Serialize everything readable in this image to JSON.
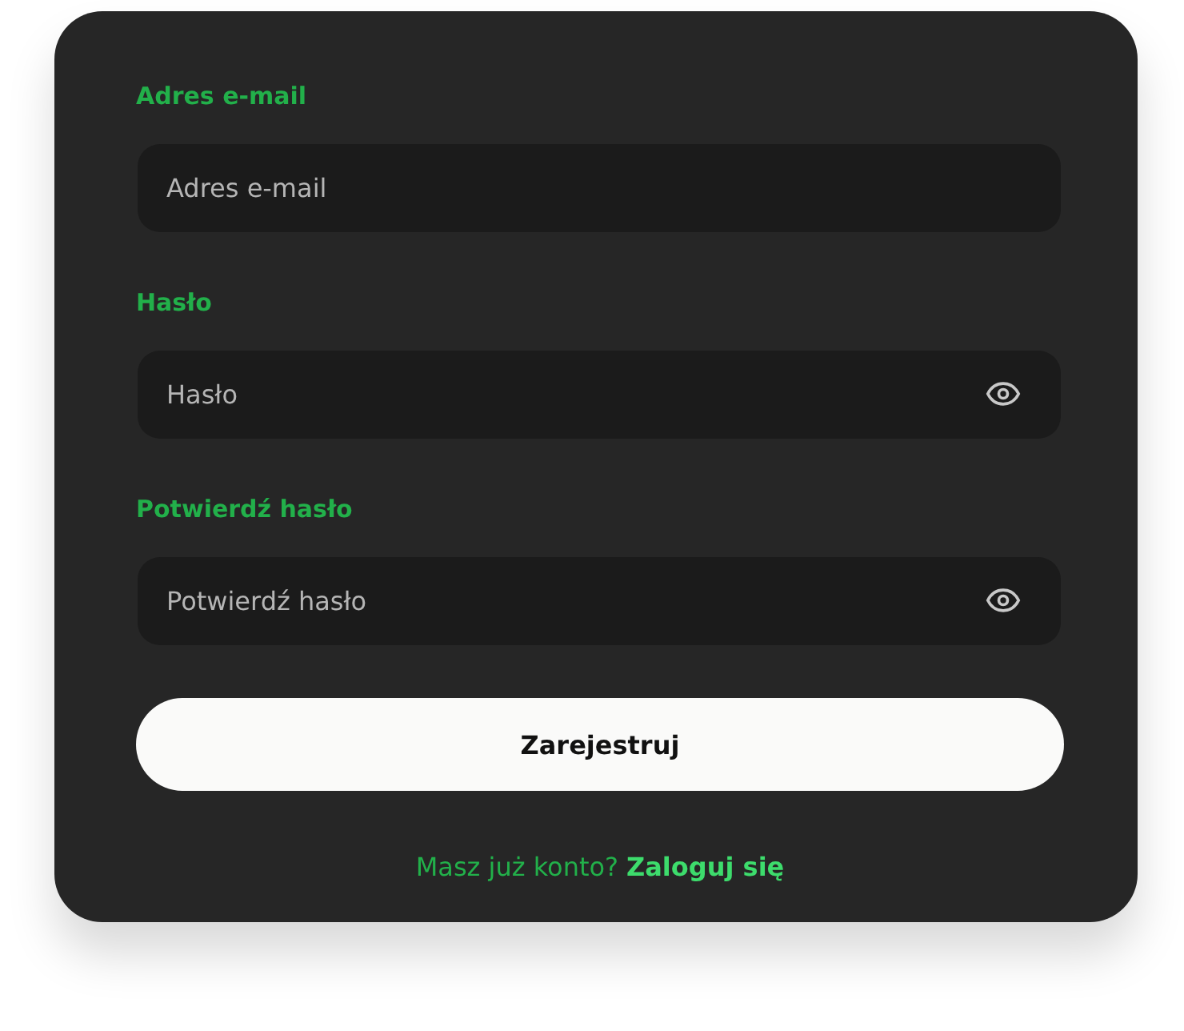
{
  "fields": [
    {
      "label": "Adres e-mail",
      "placeholder": "Adres e-mail",
      "kind": "email"
    },
    {
      "label": "Hasło",
      "placeholder": "Hasło",
      "kind": "password"
    },
    {
      "label": "Potwierdź hasło",
      "placeholder": "Potwierdź hasło",
      "kind": "password"
    }
  ],
  "submit_button": "Zarejestruj",
  "footer": {
    "prompt": "Masz już konto?",
    "link": "Zaloguj się"
  }
}
